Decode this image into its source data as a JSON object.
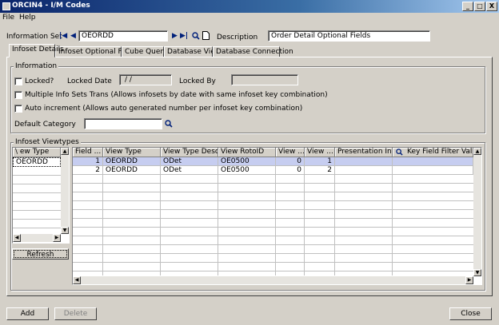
{
  "window": {
    "title": "ORCIN4 - I/M Codes",
    "minimize": "_",
    "maximize": "□",
    "close": "X"
  },
  "menu": {
    "items": [
      "File",
      "Help"
    ]
  },
  "header": {
    "info_set_label": "Information Set",
    "info_set_value": "OEORDD",
    "description_label": "Description",
    "description_value": "Order Detail Optional Fields"
  },
  "tabs": [
    "Infoset Details",
    "Infoset Optional Fields",
    "Cube Query",
    "Database View",
    "Database Connection"
  ],
  "information": {
    "title": "Information",
    "locked_label": "Locked?",
    "locked_date_label": "Locked Date",
    "locked_date_value": "/  /",
    "locked_by_label": "Locked By",
    "locked_by_value": "",
    "multiple_label": "Multiple Info Sets Trans (Allows infosets by date with same infoset key combination)",
    "auto_increment_label": "Auto increment (Allows auto generated number per infoset key combination)",
    "default_category_label": "Default Category",
    "default_category_value": ""
  },
  "viewtypes": {
    "title": "Infoset Viewtypes",
    "left_header": "\\ ew Type",
    "left_rows": [
      "OEORDD"
    ],
    "refresh_label": "Refresh",
    "columns": [
      "Field ...",
      "View Type",
      "View Type Desc...",
      "View RotoID",
      "View ...",
      "View ...",
      "Presentation Inf...",
      "Key Field Filter Value"
    ],
    "rows": [
      [
        "1",
        "OEORDD",
        "ODet",
        "OE0500",
        "0",
        "1",
        "",
        ""
      ],
      [
        "2",
        "OEORDD",
        "ODet",
        "OE0500",
        "0",
        "2",
        "",
        ""
      ]
    ]
  },
  "footer": {
    "add_label": "Add",
    "delete_label": "Delete",
    "close_label": "Close"
  },
  "colors": {
    "title_start": "#0a246a",
    "title_end": "#a6caf0",
    "selected_row": "#c6cdf0"
  }
}
